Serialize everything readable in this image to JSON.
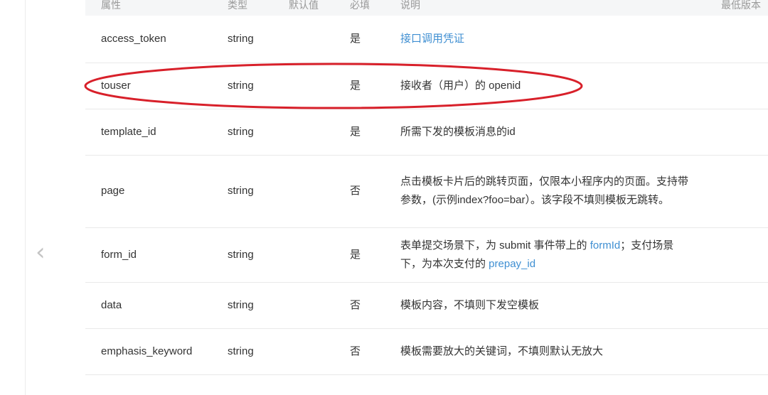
{
  "table": {
    "headers": [
      "属性",
      "类型",
      "默认值",
      "必填",
      "说明",
      "最低版本"
    ],
    "rows": [
      {
        "name": "access_token",
        "type": "string",
        "required": "是",
        "desc": [
          {
            "text": "接口调用凭证",
            "link": true
          }
        ]
      },
      {
        "name": "touser",
        "type": "string",
        "required": "是",
        "desc": [
          {
            "text": "接收者（用户）的 openid",
            "link": false
          }
        ]
      },
      {
        "name": "template_id",
        "type": "string",
        "required": "是",
        "desc": [
          {
            "text": "所需下发的模板消息的id",
            "link": false
          }
        ]
      },
      {
        "name": "page",
        "type": "string",
        "required": "否",
        "desc": [
          {
            "text": "点击模板卡片后的跳转页面，仅限本小程序内的页面。支持带参数，(示例index?foo=bar）。该字段不填则模板无跳转。",
            "link": false
          }
        ]
      },
      {
        "name": "form_id",
        "type": "string",
        "required": "是",
        "desc": [
          {
            "text": "表单提交场景下，为 submit 事件带上的 ",
            "link": false
          },
          {
            "text": "formId",
            "link": true
          },
          {
            "text": "；支付场景下，为本次支付的 ",
            "link": false
          },
          {
            "text": "prepay_id",
            "link": true
          }
        ]
      },
      {
        "name": "data",
        "type": "string",
        "required": "否",
        "desc": [
          {
            "text": "模板内容，不填则下发空模板",
            "link": false
          }
        ]
      },
      {
        "name": "emphasis_keyword",
        "type": "string",
        "required": "否",
        "desc": [
          {
            "text": "模板需要放大的关键词，不填则默认无放大",
            "link": false
          }
        ]
      }
    ]
  },
  "nav": {
    "prev_glyph": "‹"
  },
  "annotation": {
    "color": "#d8202a"
  },
  "colors": {
    "link": "#3f8fd2",
    "header_bg": "#f5f6f7",
    "border": "#e9e9e9"
  }
}
